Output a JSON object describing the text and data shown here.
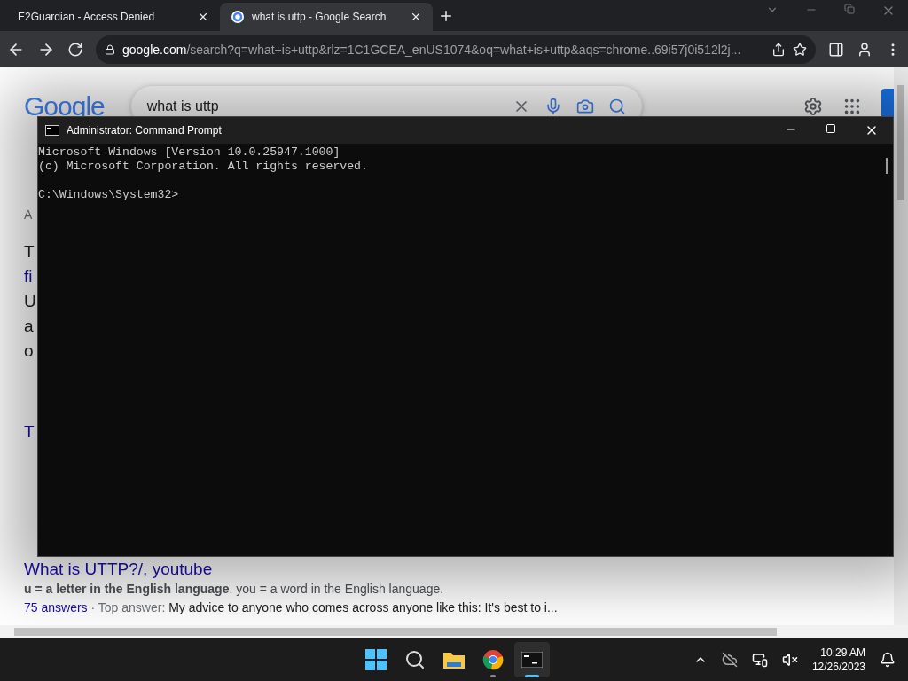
{
  "browser": {
    "tabs": [
      {
        "title": "E2Guardian - Access Denied",
        "selected": false,
        "favicon": false
      },
      {
        "title": "what is uttp - Google Search",
        "selected": true,
        "favicon": true
      }
    ],
    "url_host": "google.com",
    "url_path": "/search?q=what+is+uttp&rlz=1C1GCEA_enUS1074&oq=what+is+uttp&aqs=chrome..69i57j0i512l2j..."
  },
  "google": {
    "logo": "Google",
    "query": "what is uttp",
    "fragments": [
      {
        "text": "A",
        "kind": "meta"
      },
      {
        "text": "T",
        "kind": "body"
      },
      {
        "text": "fi",
        "kind": "link"
      },
      {
        "text": "U",
        "kind": "body"
      },
      {
        "text": "a",
        "kind": "body"
      },
      {
        "text": "o",
        "kind": "body"
      },
      {
        "text": "T",
        "kind": "title"
      }
    ],
    "result": {
      "title": "What is UTTP?/, youtube",
      "snippet": "**u = a letter in the English language**. you = a word in the English language.",
      "answers": "75 answers",
      "meta": " · Top answer: ",
      "answer": "My advice to anyone who comes across anyone like this: It's best to i..."
    }
  },
  "console": {
    "title": "Administrator: Command Prompt",
    "lines": [
      "Microsoft Windows [Version 10.0.25947.1000]",
      "(c) Microsoft Corporation. All rights reserved."
    ],
    "prompt": "C:\\Windows\\System32>"
  },
  "taskbar": {
    "apps": [
      {
        "kind": "start",
        "active": false
      },
      {
        "kind": "search",
        "active": false
      },
      {
        "kind": "files",
        "active": false
      },
      {
        "kind": "chrome",
        "active": false
      },
      {
        "kind": "terminal",
        "active": true
      }
    ],
    "time": "10:29 AM",
    "date": "12/26/2023"
  }
}
